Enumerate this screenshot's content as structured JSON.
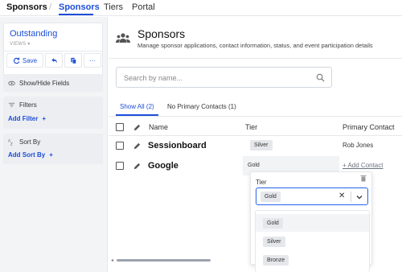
{
  "topnav": {
    "app_name": "Sponsors",
    "separator": "/",
    "tabs": [
      "Sponsors",
      "Tiers",
      "Portal"
    ]
  },
  "sidebar": {
    "view": {
      "title": "Outstanding",
      "subtitle": "VIEWS ▾"
    },
    "save_label": "Save",
    "more_label": "···",
    "show_hide": "Show/Hide Fields",
    "filters": {
      "title": "Filters",
      "add": "Add Filter"
    },
    "sort": {
      "title": "Sort By",
      "add": "Add Sort By"
    }
  },
  "main": {
    "title": "Sponsors",
    "subtitle": "Manage sponsor applications, contact information, status, and event participation details",
    "search_placeholder": "Search by name...",
    "view_tabs": [
      "Show All (2)",
      "No Primary Contacts (1)"
    ],
    "columns": [
      "Name",
      "Tier",
      "Primary Contact"
    ],
    "rows": [
      {
        "name": "Sessionboard",
        "tier": "Silver",
        "contact": "Rob Jones"
      },
      {
        "name": "Google",
        "tier": "Gold",
        "contact": "+ Add Contact"
      }
    ]
  },
  "tier_dropdown": {
    "label": "Tier",
    "selected": "Gold",
    "clear": "✕",
    "options": [
      "Gold",
      "Silver",
      "Bronze"
    ]
  },
  "colors": {
    "accent": "#1d4ed8",
    "chip": "#e5e7eb"
  }
}
